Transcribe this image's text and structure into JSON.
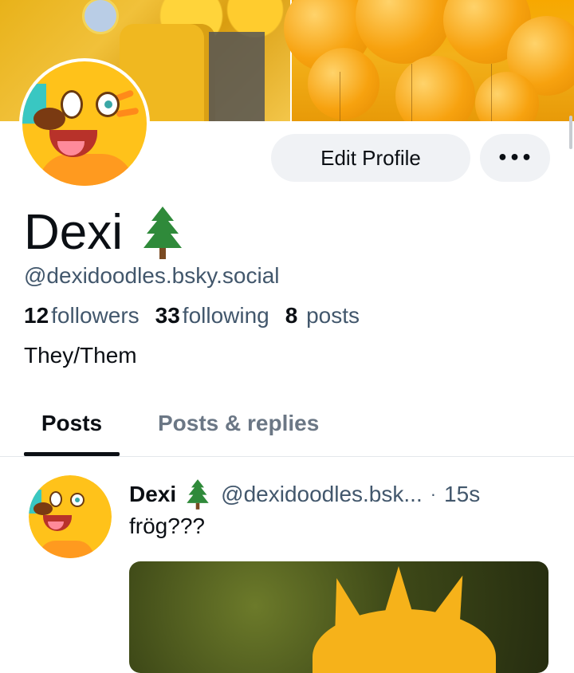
{
  "profile": {
    "display_name": "Dexi",
    "name_emoji_icon": "evergreen-tree-icon",
    "handle": "@dexidoodles.bsky.social",
    "pronouns": "They/Them",
    "stats": {
      "followers_count": "12",
      "followers_label": "followers",
      "following_count": "33",
      "following_label": "following",
      "posts_count": "8",
      "posts_label": "posts"
    }
  },
  "actions": {
    "edit_profile_label": "Edit Profile",
    "more_label": "•••"
  },
  "tabs": [
    {
      "label": "Posts",
      "active": true
    },
    {
      "label": "Posts & replies",
      "active": false
    }
  ],
  "post": {
    "author": "Dexi",
    "handle": "@dexidoodles.bsk...",
    "separator": "·",
    "time": "15s",
    "text": "frög???"
  },
  "colors": {
    "text_primary": "#0b0f14",
    "text_secondary": "#42576c",
    "button_bg": "#f0f2f5",
    "tab_inactive": "#6b7785"
  }
}
